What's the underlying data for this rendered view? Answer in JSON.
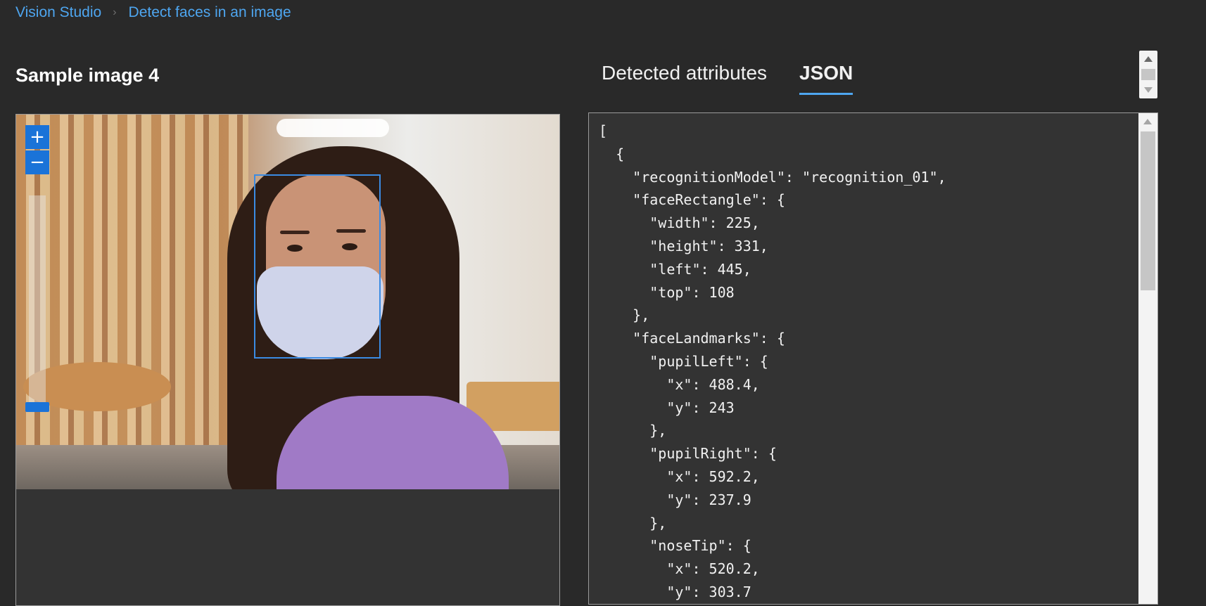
{
  "breadcrumb": {
    "root": "Vision Studio",
    "separator": "›",
    "current": "Detect faces in an image"
  },
  "page": {
    "title": "Sample image 4"
  },
  "tabs": [
    {
      "label": "Detected attributes",
      "active": false
    },
    {
      "label": "JSON",
      "active": true
    }
  ],
  "image": {
    "zoom_in": "+",
    "zoom_out": "−"
  },
  "json_output": {
    "lines": [
      "[",
      "  {",
      "    \"recognitionModel\": \"recognition_01\",",
      "    \"faceRectangle\": {",
      "      \"width\": 225,",
      "      \"height\": 331,",
      "      \"left\": 445,",
      "      \"top\": 108",
      "    },",
      "    \"faceLandmarks\": {",
      "      \"pupilLeft\": {",
      "        \"x\": 488.4,",
      "        \"y\": 243",
      "      },",
      "      \"pupilRight\": {",
      "        \"x\": 592.2,",
      "        \"y\": 237.9",
      "      },",
      "      \"noseTip\": {",
      "        \"x\": 520.2,",
      "        \"y\": 303.7"
    ]
  },
  "colors": {
    "background": "#292929",
    "panel": "#333333",
    "accent": "#4ea6f0",
    "button": "#1a73d8",
    "face_box": "#3b8be3"
  },
  "icons": [
    "chevron-right-icon",
    "zoom-in-icon",
    "zoom-out-icon",
    "scroll-up-icon",
    "scroll-down-icon"
  ]
}
